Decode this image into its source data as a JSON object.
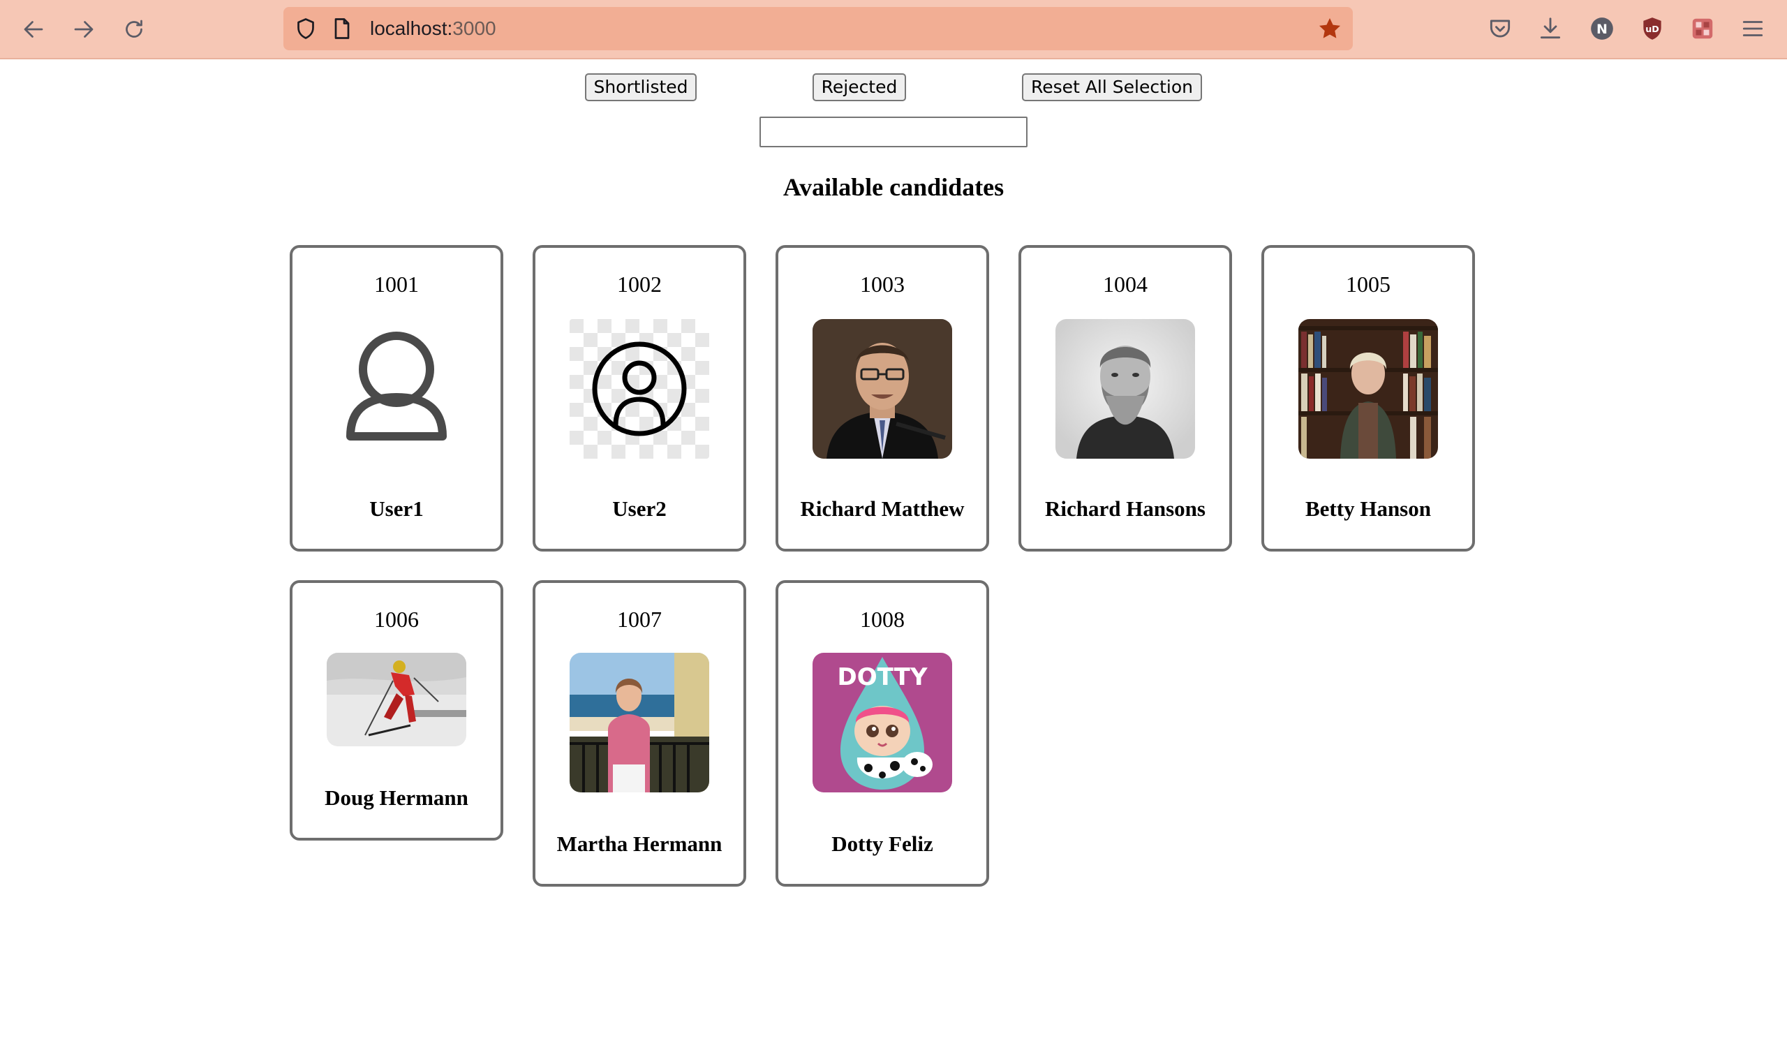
{
  "browser": {
    "url_host": "localhost:",
    "url_port": "3000",
    "profile_initial": "N",
    "extension_label": "uD"
  },
  "controls": {
    "shortlisted_label": "Shortlisted",
    "rejected_label": "Rejected",
    "reset_label": "Reset All Selection",
    "search_value": ""
  },
  "heading": "Available candidates",
  "candidates": [
    {
      "id": "1001",
      "name": "User1",
      "photo": "person-outline-icon"
    },
    {
      "id": "1002",
      "name": "User2",
      "photo": "user-circle-icon"
    },
    {
      "id": "1003",
      "name": "Richard Matthew",
      "photo": "photo-man-speaking"
    },
    {
      "id": "1004",
      "name": "Richard Hansons",
      "photo": "photo-vintage-portrait"
    },
    {
      "id": "1005",
      "name": "Betty Hanson",
      "photo": "photo-woman-bookshelf"
    },
    {
      "id": "1006",
      "name": "Doug Hermann",
      "photo": "photo-skier"
    },
    {
      "id": "1007",
      "name": "Martha Hermann",
      "photo": "photo-woman-balcony"
    },
    {
      "id": "1008",
      "name": "Dotty Feliz",
      "photo": "dotty-doll-logo",
      "logo_text": "DOTTY"
    }
  ]
}
